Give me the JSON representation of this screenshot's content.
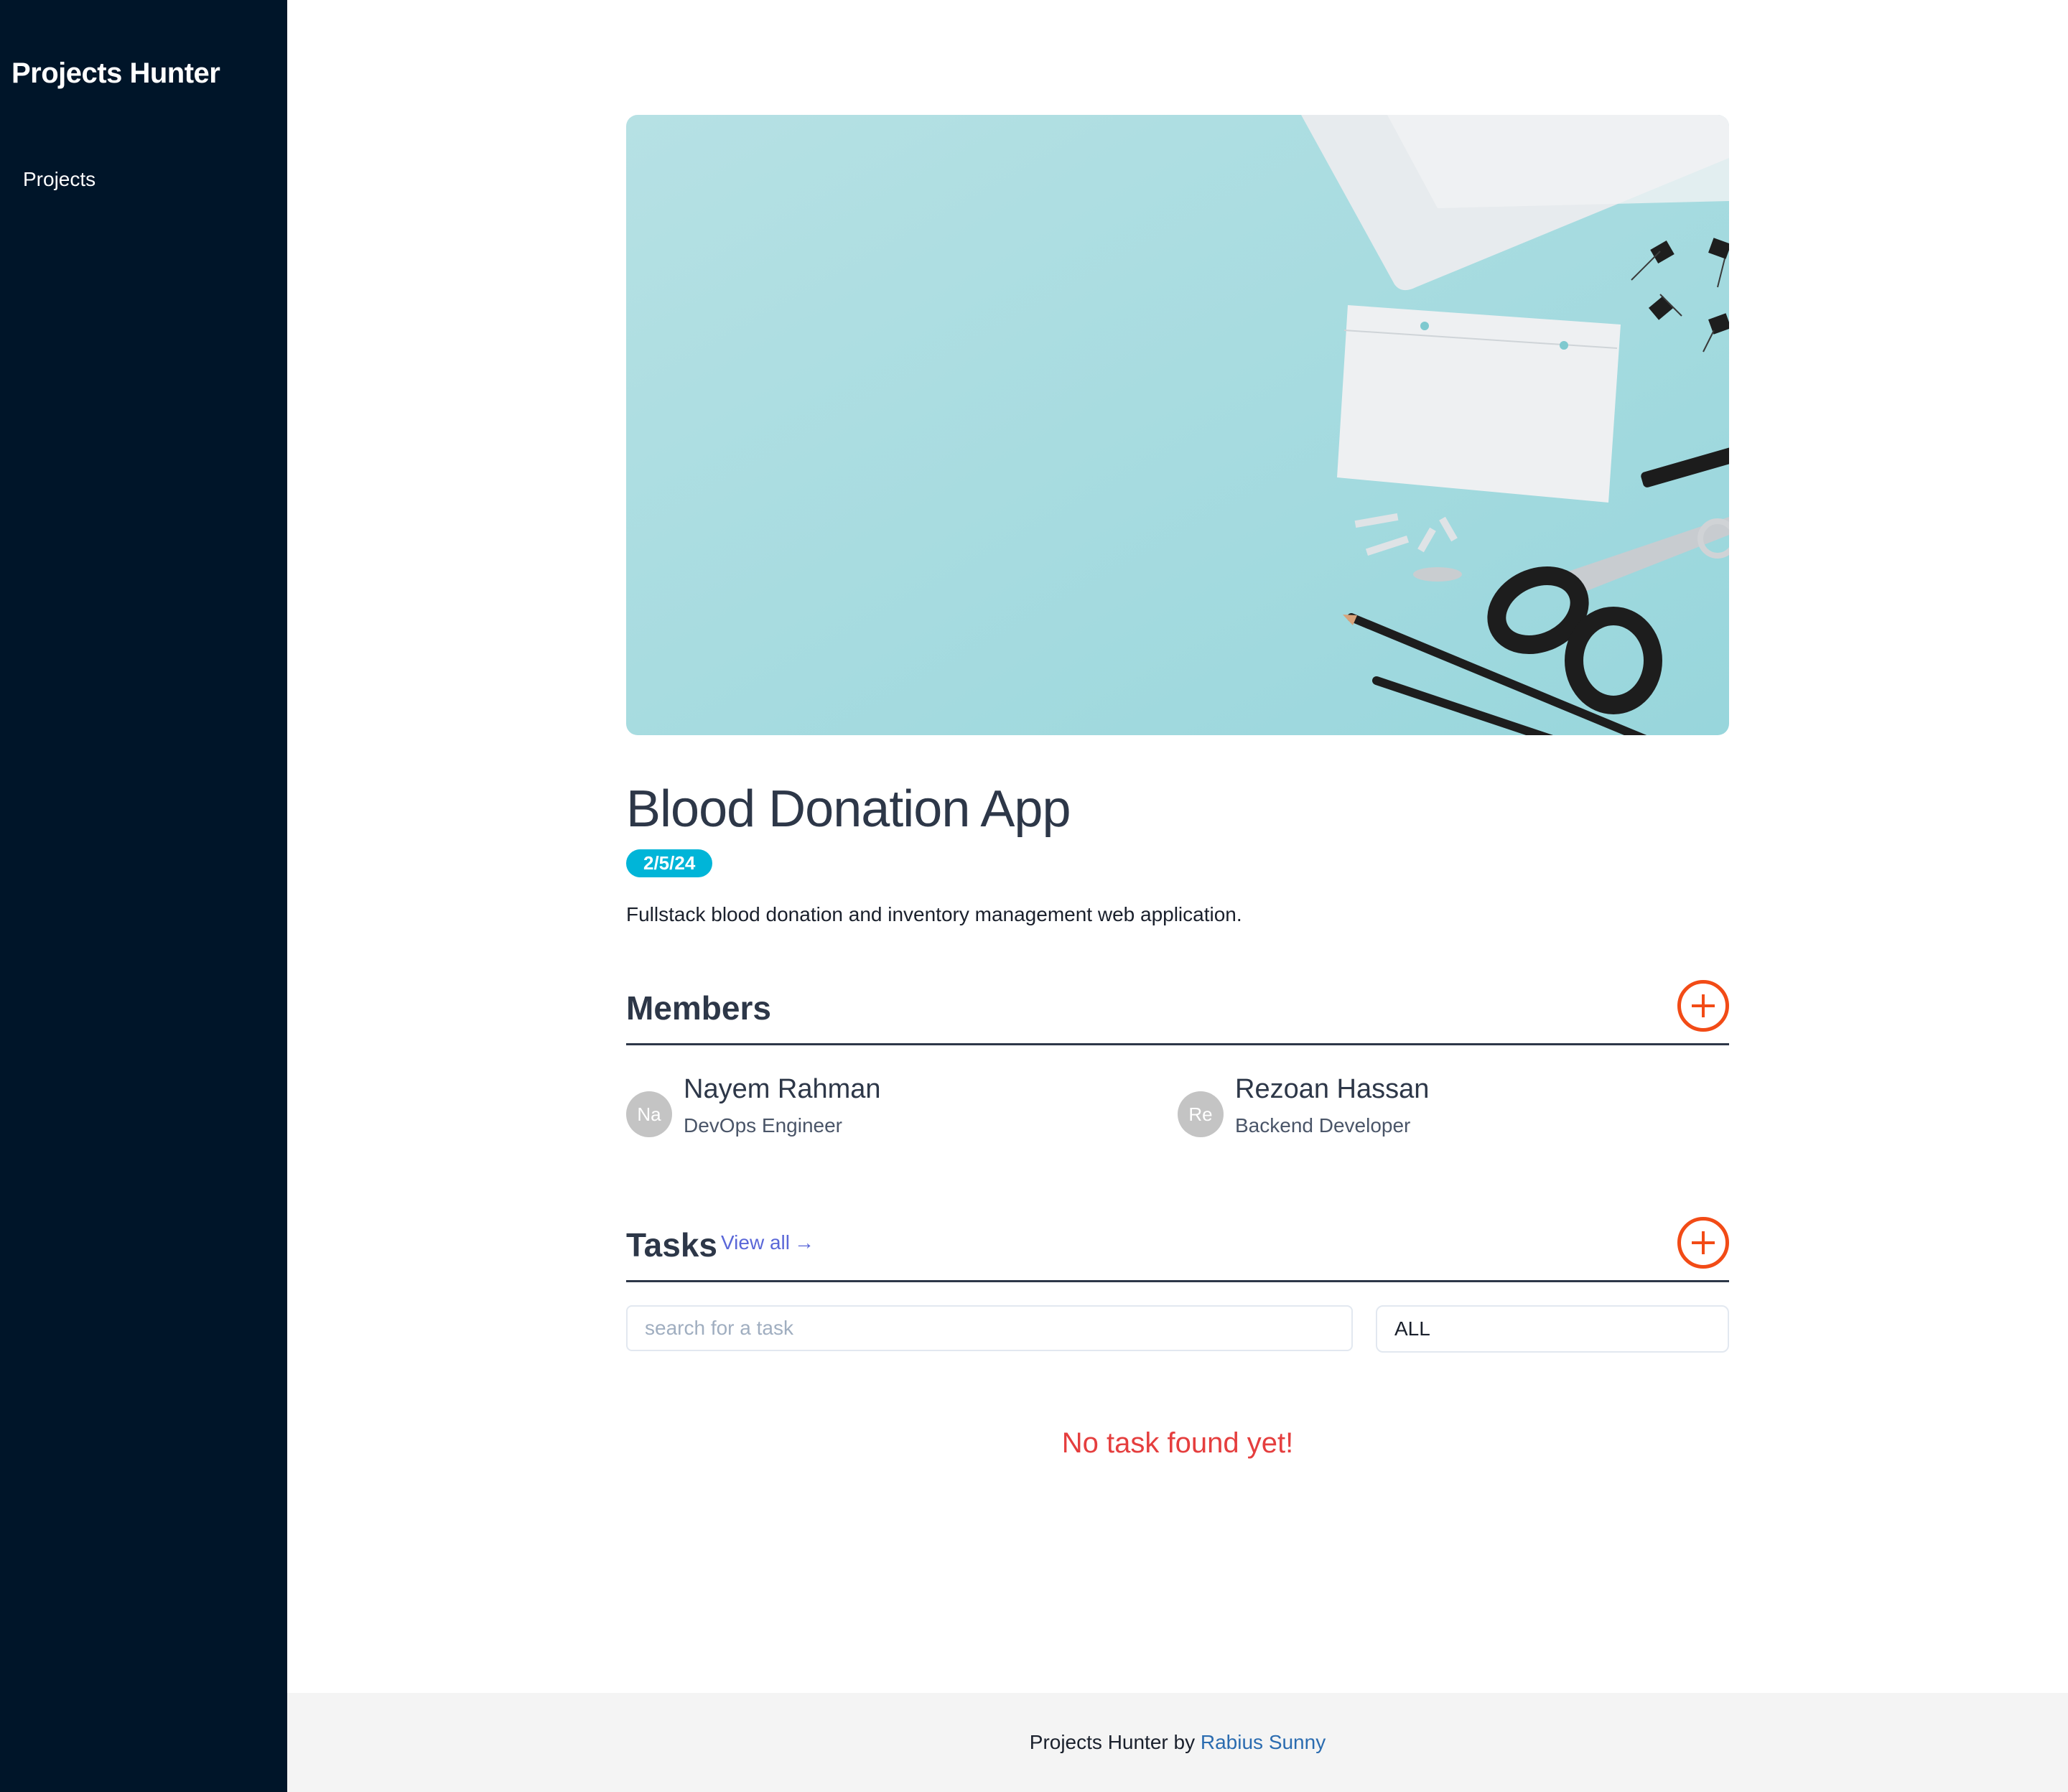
{
  "sidebar": {
    "brand": "Projects Hunter",
    "nav": [
      {
        "label": "Projects"
      }
    ]
  },
  "project": {
    "title": "Blood Donation App",
    "date": "2/5/24",
    "description": "Fullstack blood donation and inventory management web application.",
    "hero_image": "desk-supplies-on-light-blue-background"
  },
  "members": {
    "title": "Members",
    "list": [
      {
        "initials": "Na",
        "name": "Nayem Rahman",
        "role": "DevOps Engineer"
      },
      {
        "initials": "Re",
        "name": "Rezoan Hassan",
        "role": "Backend Developer"
      }
    ]
  },
  "tasks": {
    "title": "Tasks",
    "view_all": "View all",
    "search_placeholder": "search for a task",
    "filter_value": "ALL",
    "empty_message": "No task found yet!"
  },
  "footer": {
    "text": "Projects Hunter by",
    "author": "Rabius Sunny"
  },
  "colors": {
    "sidebar_bg": "#001529",
    "accent_orange": "#f24b16",
    "badge_cyan": "#00b5d8",
    "empty_red": "#e53e3e",
    "link_purple": "#5a67d8",
    "footer_link": "#2b6cb0"
  }
}
